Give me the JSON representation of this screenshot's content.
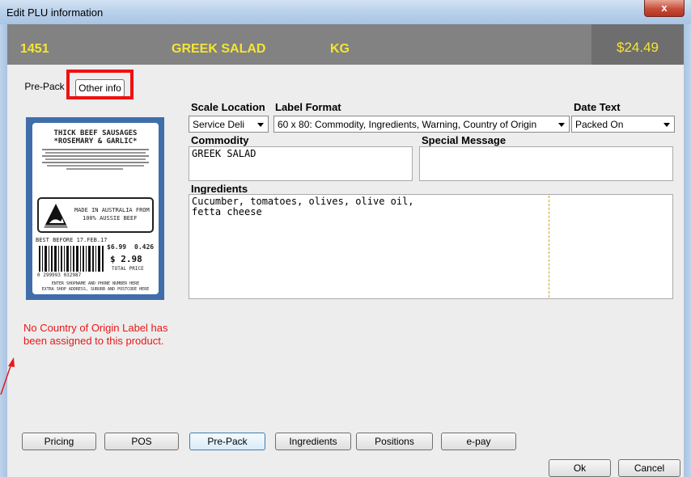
{
  "window": {
    "title": "Edit PLU information",
    "close_glyph": "x"
  },
  "header": {
    "plu": "1451",
    "name": "GREEK SALAD",
    "unit": "KG",
    "price": "$24.49"
  },
  "tabs": [
    {
      "label": "Pre-Pack"
    },
    {
      "label": "Other info"
    }
  ],
  "fields": {
    "scale_location": {
      "label": "Scale Location",
      "value": "Service Deli"
    },
    "label_format": {
      "label": "Label Format",
      "value": "60 x 80: Commodity, Ingredients, Warning, Country of Origin"
    },
    "date_text": {
      "label": "Date Text",
      "value": "Packed On"
    },
    "commodity": {
      "label": "Commodity",
      "value": "GREEK SALAD"
    },
    "special_message": {
      "label": "Special Message",
      "value": ""
    },
    "ingredients": {
      "label": "Ingredients",
      "value": "Cucumber, tomatoes, olives, olive oil,\nfetta cheese"
    }
  },
  "label_preview": {
    "line1": "THICK BEEF SAUSAGES",
    "line2": "*ROSEMARY & GARLIC*",
    "made_in": "MADE IN AUSTRALIA FROM",
    "made_in2": "100% AUSSIE BEEF",
    "best_before": "BEST BEFORE 17.FEB.17",
    "price_kg": "$6.99",
    "net_wt": "0.426",
    "total": "$ 2.98",
    "total_label": "TOTAL PRICE",
    "barcode_num": "0 299993 032987",
    "footer1": "ENTER SHOPNAME AND PHONE NUMBER HERE",
    "footer2": "EXTRA SHOP ADDRESS, SUBURB AND POSTCODE HERE"
  },
  "note": "No Country of Origin Label has been assigned to this product.",
  "bottom_buttons": [
    {
      "label": "Pricing"
    },
    {
      "label": "POS"
    },
    {
      "label": "Pre-Pack"
    },
    {
      "label": "Ingredients"
    },
    {
      "label": "Positions"
    },
    {
      "label": "e-pay"
    }
  ],
  "dialog_buttons": {
    "ok": "Ok",
    "cancel": "Cancel"
  },
  "colors": {
    "header_text": "#f4e534",
    "highlight": "#ee1111",
    "note_text": "#e81818"
  }
}
